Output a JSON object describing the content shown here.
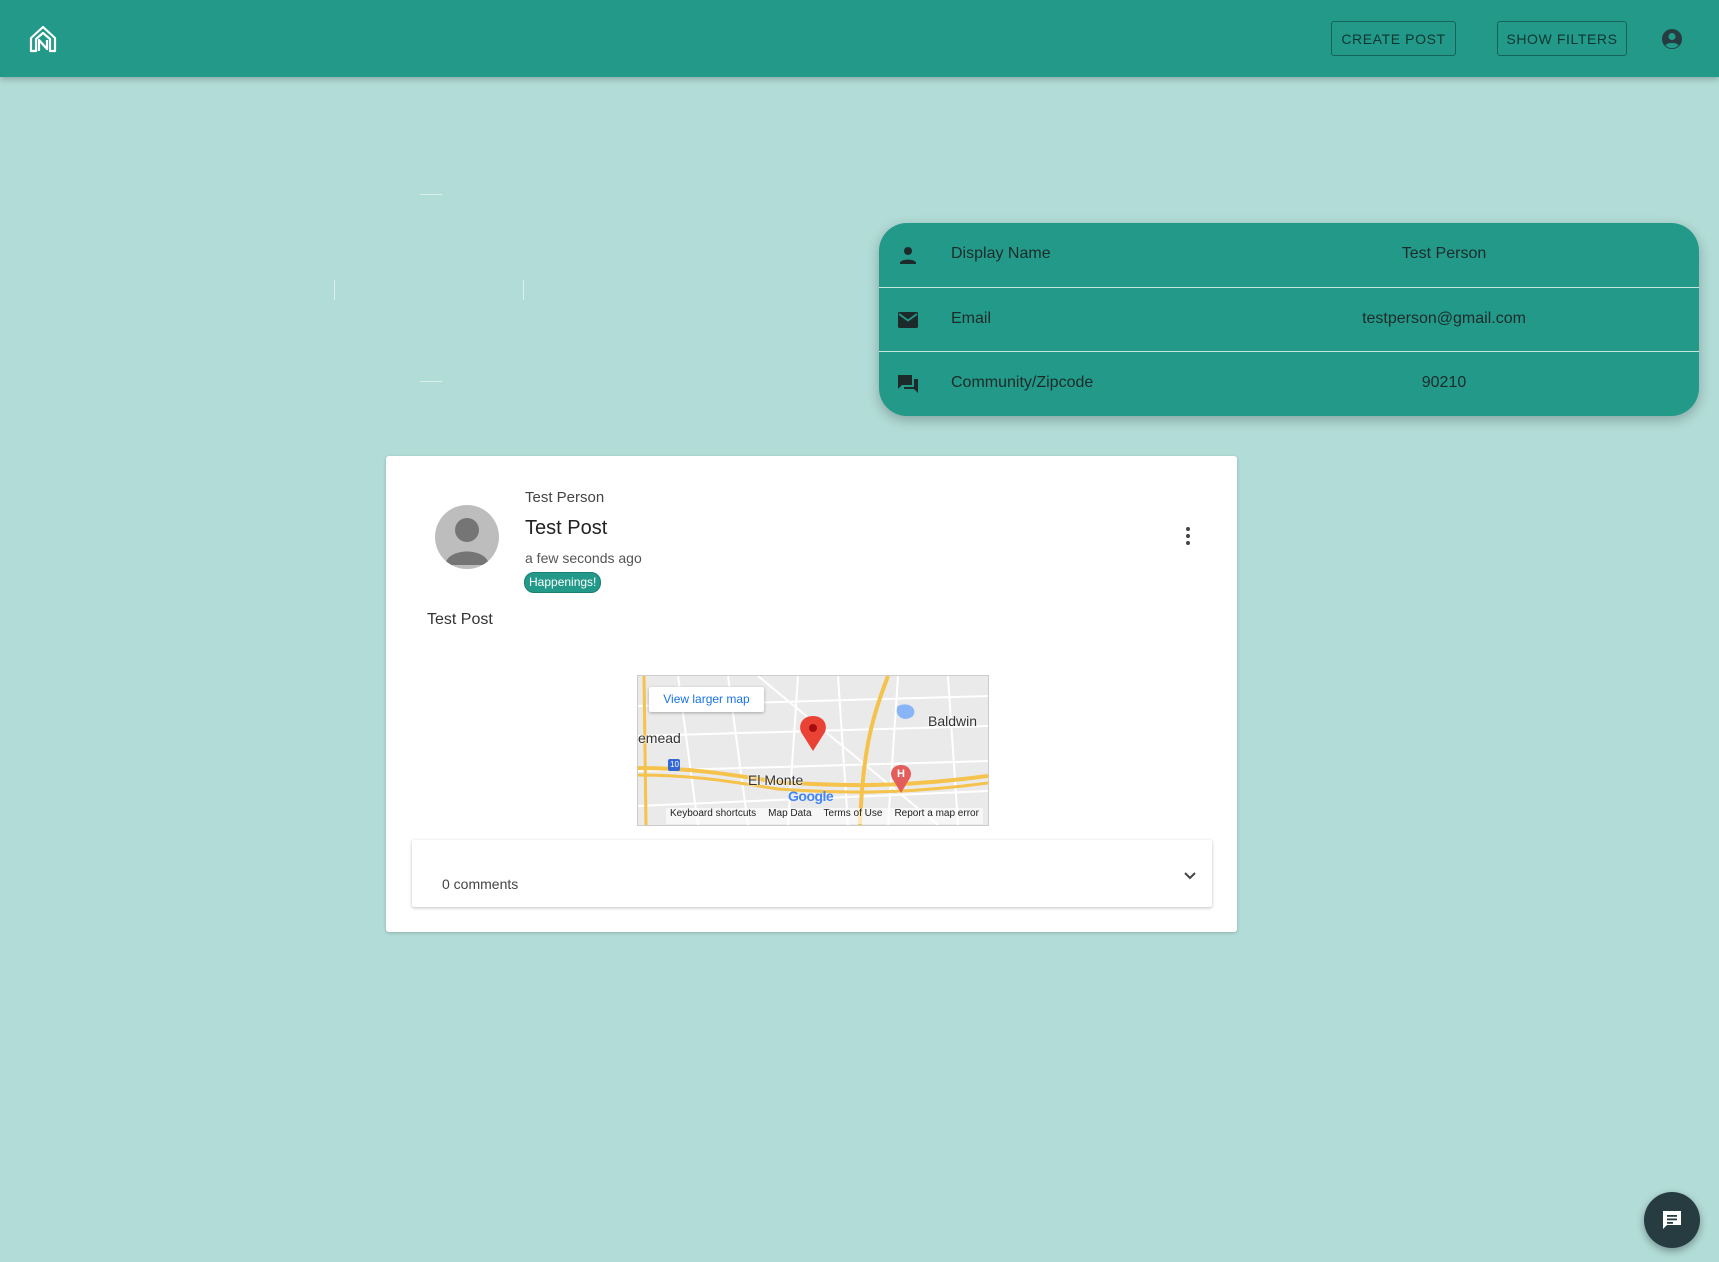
{
  "header": {
    "create_post_label": "CREATE POST",
    "show_filters_label": "SHOW FILTERS"
  },
  "profile": {
    "rows": [
      {
        "icon": "person-icon",
        "label": "Display Name",
        "value": "Test Person"
      },
      {
        "icon": "email-icon",
        "label": "Email",
        "value": "testperson@gmail.com"
      },
      {
        "icon": "forum-icon",
        "label": "Community/Zipcode",
        "value": "90210"
      }
    ]
  },
  "post": {
    "author": "Test Person",
    "title": "Test Post",
    "time": "a few seconds ago",
    "tag": "Happenings!",
    "body": "Test Post",
    "map": {
      "view_larger_label": "View larger map",
      "places": [
        "emead",
        "Baldwin",
        "El Monte"
      ],
      "highway_shield": "10",
      "attribution": "Google",
      "footer": [
        "Keyboard shortcuts",
        "Map Data",
        "Terms of Use",
        "Report a map error"
      ]
    },
    "comments_label": "0 comments"
  },
  "colors": {
    "background": "#b2dcd7",
    "appbar": "#229989",
    "card": "#ffffff",
    "fab": "#263c40"
  }
}
